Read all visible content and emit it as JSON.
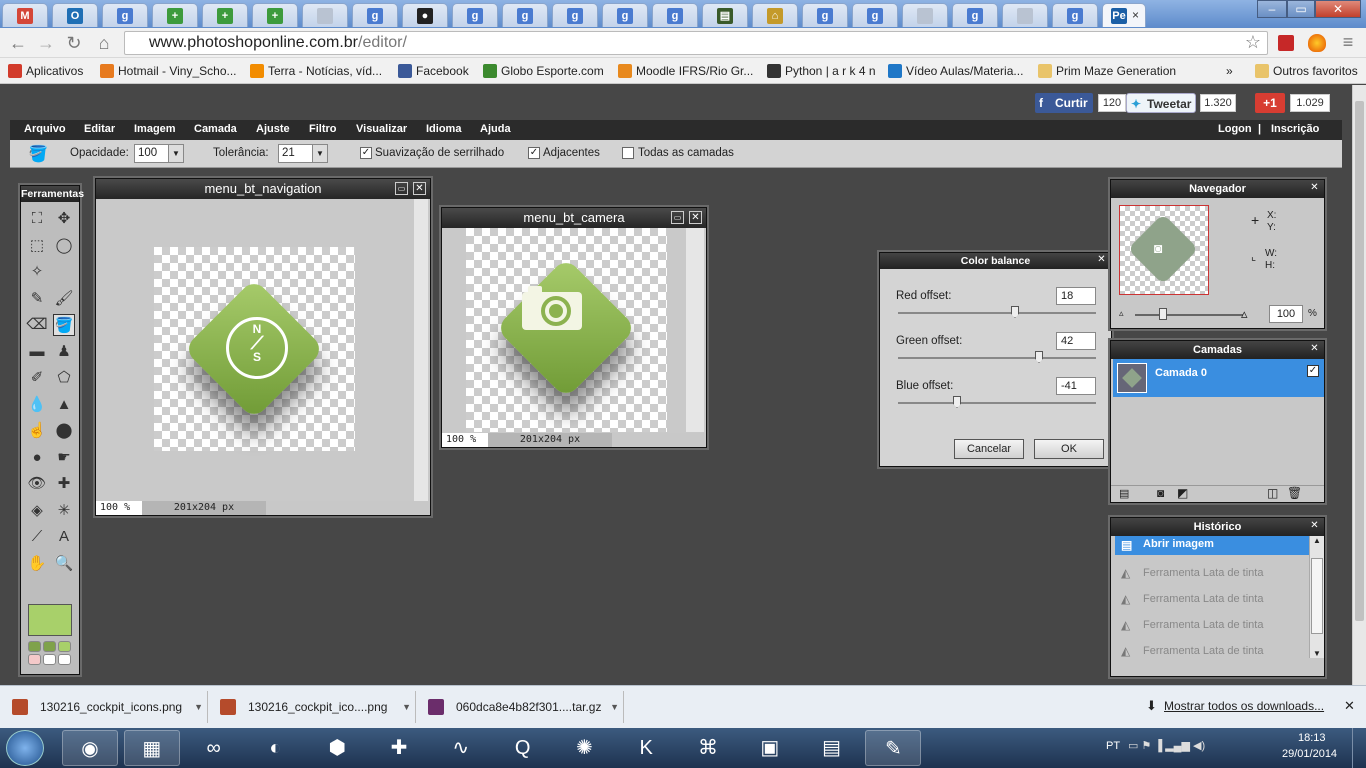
{
  "browser": {
    "tabs": [
      {
        "icon": "gmail-icon",
        "color": "#d44638",
        "glyph": "M"
      },
      {
        "icon": "outlook-icon",
        "color": "#1f6fb5",
        "glyph": "O"
      },
      {
        "icon": "google-search-icon",
        "color": "#4a7bd0",
        "glyph": "g"
      },
      {
        "icon": "add-tab-icon",
        "color": "#3d9b3d",
        "glyph": "+"
      },
      {
        "icon": "add-tab-icon",
        "color": "#3d9b3d",
        "glyph": "+"
      },
      {
        "icon": "add-tab-icon",
        "color": "#3d9b3d",
        "glyph": "+"
      },
      {
        "icon": "document-icon",
        "color": "#b9c3d2",
        "glyph": ""
      },
      {
        "icon": "google-search-icon",
        "color": "#4a7bd0",
        "glyph": "g"
      },
      {
        "icon": "github-icon",
        "color": "#222222",
        "glyph": "●"
      },
      {
        "icon": "google-search-icon",
        "color": "#4a7bd0",
        "glyph": "g"
      },
      {
        "icon": "google-search-icon",
        "color": "#4a7bd0",
        "glyph": "g"
      },
      {
        "icon": "google-search-icon",
        "color": "#4a7bd0",
        "glyph": "g"
      },
      {
        "icon": "google-search-icon",
        "color": "#4a7bd0",
        "glyph": "g"
      },
      {
        "icon": "google-search-icon",
        "color": "#4a7bd0",
        "glyph": "g"
      },
      {
        "icon": "terminal-icon",
        "color": "#3a5a2a",
        "glyph": "▤"
      },
      {
        "icon": "house-icon",
        "color": "#c49a2a",
        "glyph": "⌂"
      },
      {
        "icon": "google-search-icon",
        "color": "#4a7bd0",
        "glyph": "g"
      },
      {
        "icon": "google-search-icon",
        "color": "#4a7bd0",
        "glyph": "g"
      },
      {
        "icon": "document-icon",
        "color": "#b9c3d2",
        "glyph": ""
      },
      {
        "icon": "google-search-icon",
        "color": "#4a7bd0",
        "glyph": "g"
      },
      {
        "icon": "document-icon",
        "color": "#b9c3d2",
        "glyph": ""
      },
      {
        "icon": "google-search-icon",
        "color": "#4a7bd0",
        "glyph": "g"
      },
      {
        "icon": "photoshop-online-icon",
        "color": "#1b5fa6",
        "glyph": "Pe",
        "active": true
      }
    ],
    "url_domain": "www.photoshoponline.com.br",
    "url_path": "/editor/",
    "bookmarks": [
      {
        "label": "Aplicativos",
        "color": "#d23b2b"
      },
      {
        "label": "Hotmail - Viny_Scho...",
        "color": "#e77a1e"
      },
      {
        "label": "Terra - Notícias, víd...",
        "color": "#f28c00"
      },
      {
        "label": "Facebook",
        "color": "#3b5998"
      },
      {
        "label": "Globo Esporte.com",
        "color": "#3c8a2e"
      },
      {
        "label": "Moodle IFRS/Rio Gr...",
        "color": "#e8891d"
      },
      {
        "label": "Python | a r k 4 n",
        "color": "#333333"
      },
      {
        "label": "Vídeo Aulas/Materia...",
        "color": "#1f77c7"
      },
      {
        "label": "Prim Maze Generation",
        "color": "#e9c46a"
      }
    ],
    "bookmarks_more": "»",
    "other_bookmarks": "Outros favoritos"
  },
  "social": {
    "facebook_label": "Curtir",
    "facebook_count": "120",
    "twitter_label": "Tweetar",
    "twitter_count": "1.320",
    "gplus_label": "+1",
    "gplus_count": "1.029"
  },
  "editor": {
    "menu": [
      "Arquivo",
      "Editar",
      "Imagem",
      "Camada",
      "Ajuste",
      "Filtro",
      "Visualizar",
      "Idioma",
      "Ajuda"
    ],
    "account": {
      "logon": "Logon",
      "sep": "|",
      "signup": "Inscrição"
    },
    "options": {
      "opacity_label": "Opacidade:",
      "opacity_value": "100",
      "tolerance_label": "Tolerância:",
      "tolerance_value": "21",
      "antialias_label": "Suavização de serrilhado",
      "antialias_checked": true,
      "contiguous_label": "Adjacentes",
      "contiguous_checked": true,
      "all_layers_label": "Todas as camadas",
      "all_layers_checked": false
    },
    "tools_title": "Ferramentas",
    "foreground_color": "#a8d06a",
    "documents": [
      {
        "title": "menu_bt_navigation",
        "zoom": "100 %",
        "size": "201x204 px",
        "icon": "compass-icon",
        "letters": [
          "N",
          "S"
        ]
      },
      {
        "title": "menu_bt_camera",
        "zoom": "100 %",
        "size": "201x204 px",
        "icon": "camera-icon"
      }
    ],
    "color_balance": {
      "title": "Color balance",
      "rows": [
        {
          "label": "Red offset:",
          "value": "18",
          "level": 0.59
        },
        {
          "label": "Green offset:",
          "value": "42",
          "level": 0.71
        },
        {
          "label": "Blue offset:",
          "value": "-41",
          "level": 0.3
        }
      ],
      "cancel": "Cancelar",
      "ok": "OK"
    },
    "navigator": {
      "title": "Navegador",
      "x_label": "X:",
      "y_label": "Y:",
      "w_label": "W:",
      "h_label": "H:",
      "zoom_value": "100",
      "zoom_unit": "%"
    },
    "layers": {
      "title": "Camadas",
      "items": [
        {
          "name": "Camada 0",
          "visible": true
        }
      ]
    },
    "history": {
      "title": "Histórico",
      "items": [
        "Abrir imagem",
        "Ferramenta Lata de tinta",
        "Ferramenta Lata de tinta",
        "Ferramenta Lata de tinta",
        "Ferramenta Lata de tinta"
      ]
    }
  },
  "downloads": {
    "items": [
      "130216_cockpit_icons.png",
      "130216_cockpit_ico....png",
      "060dca8e4b82f301....tar.gz"
    ],
    "show_all": "Mostrar todos os downloads..."
  },
  "taskbar": {
    "apps": [
      "chrome-icon",
      "file-explorer-icon",
      "arduino-icon",
      "eclipse-icon",
      "virtualbox-icon",
      "puzzle-icon",
      "oscilloscope-icon",
      "qt-icon",
      "spider-icon",
      "kaspersky-icon",
      "python-icon",
      "image-viewer-icon",
      "winrar-icon",
      "paint-icon"
    ],
    "lang": "PT",
    "time": "18:13",
    "date": "29/01/2014"
  }
}
